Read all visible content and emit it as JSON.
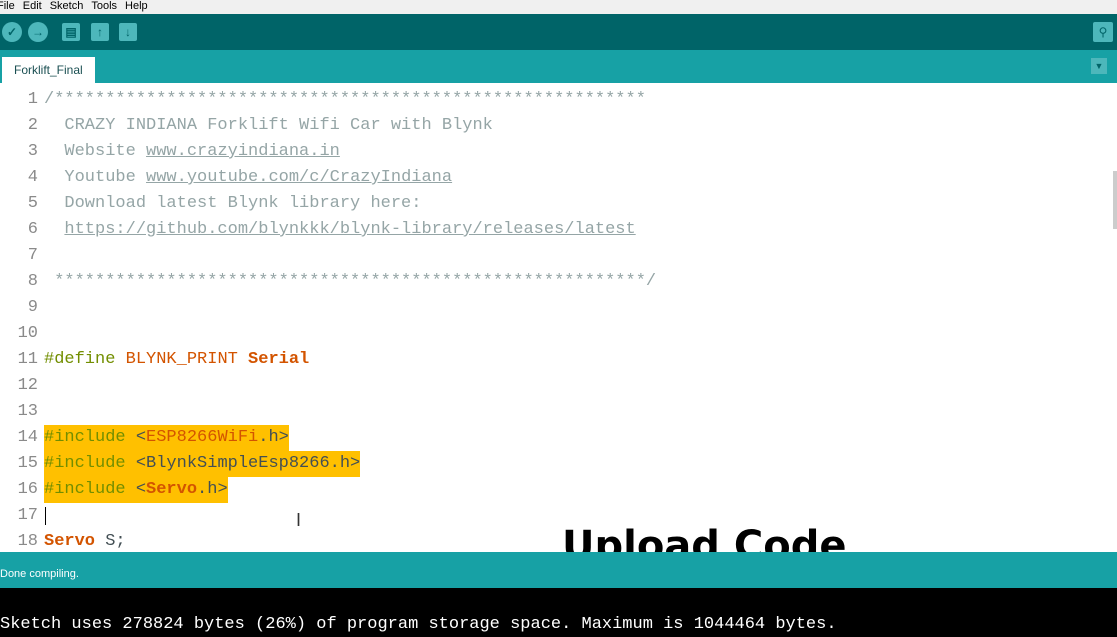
{
  "menu": [
    "File",
    "Edit",
    "Sketch",
    "Tools",
    "Help"
  ],
  "toolbar": {
    "buttons": [
      "verify-icon",
      "upload-icon",
      "new-icon",
      "open-icon",
      "save-icon"
    ],
    "serial_monitor": "serial-monitor-icon"
  },
  "tab": {
    "label": "Forklift_Final"
  },
  "code": {
    "l1": "/**********************************************************",
    "l2": "  CRAZY INDIANA Forklift Wifi Car with Blynk",
    "l3a": "  Website ",
    "l3b": "www.crazyindiana.in",
    "l4a": "  Youtube ",
    "l4b": "www.youtube.com/c/CrazyIndiana",
    "l5": "  Download latest Blynk library here:",
    "l6a": "  ",
    "l6b": "https://github.com/blynkkk/blynk-library/releases/latest",
    "l8": " **********************************************************/",
    "l11a": "#define",
    "l11b": " ",
    "l11c": "BLYNK_PRINT",
    "l11d": " ",
    "l11e": "Serial",
    "l14a": "#include",
    "l14b": " <",
    "l14c": "ESP8266WiFi",
    "l14d": ".h>",
    "l15a": "#include",
    "l15b": " <BlynkSimpleEsp8266.h>",
    "l16a": "#include",
    "l16b": " <",
    "l16c": "Servo",
    "l16d": ".h>",
    "l18a": "Servo",
    "l18b": " S;"
  },
  "overlay": "Upload Code",
  "status": "Done compiling.",
  "console": "Sketch uses 278824 bytes (26%) of program storage space. Maximum is 1044464 bytes."
}
